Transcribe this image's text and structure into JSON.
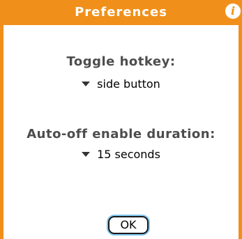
{
  "dialog": {
    "title": "Preferences",
    "info_icon": "info-icon",
    "accent_color": "#f0901a"
  },
  "toggle_hotkey": {
    "label": "Toggle hotkey:",
    "value": "side button"
  },
  "auto_off": {
    "label": "Auto-off enable duration:",
    "value": "15 seconds"
  },
  "buttons": {
    "ok_label": "OK"
  }
}
